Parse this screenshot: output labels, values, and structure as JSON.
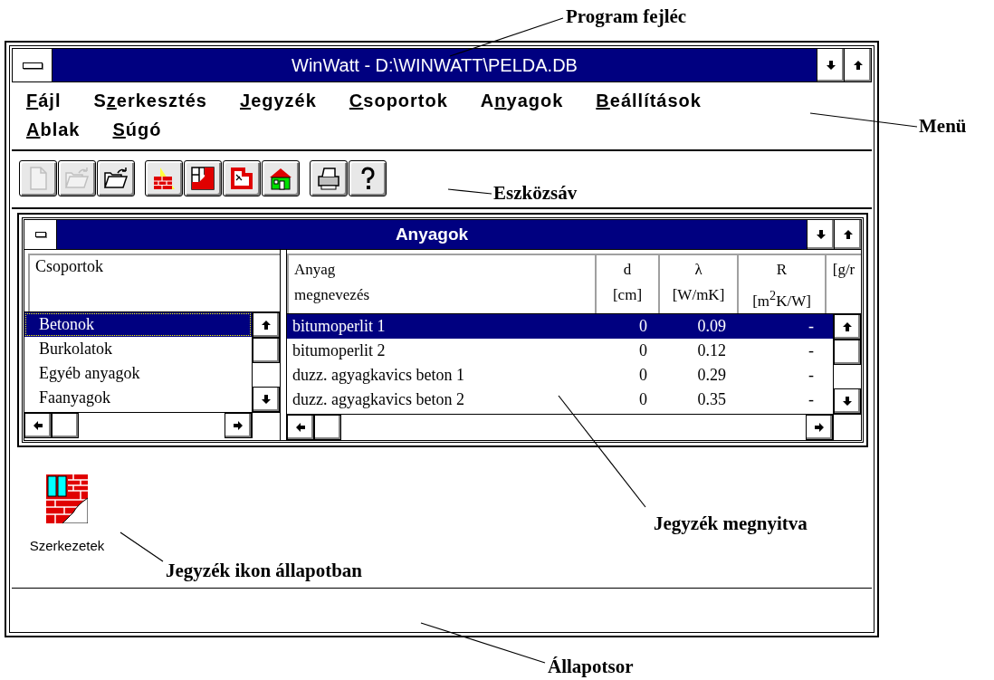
{
  "window": {
    "title": "WinWatt - D:\\WINWATT\\PELDA.DB"
  },
  "menu_rows": [
    [
      {
        "key": "F",
        "rest": "ájl"
      },
      {
        "lead": "S",
        "key": "z",
        "rest": "erkesztés"
      },
      {
        "key": "J",
        "rest": "egyzék"
      },
      {
        "key": "C",
        "rest": "soportok"
      },
      {
        "lead": "A",
        "key": "n",
        "rest": "yagok"
      },
      {
        "key": "B",
        "rest": "eállítások"
      }
    ],
    [
      {
        "key": "A",
        "rest": "blak"
      },
      {
        "key": "S",
        "rest": "úgó"
      }
    ]
  ],
  "toolbar": [
    [
      {
        "kind": "new-file",
        "disabled": true
      },
      {
        "kind": "open-folder",
        "disabled": true
      },
      {
        "kind": "open-folder",
        "disabled": false
      }
    ],
    [
      {
        "kind": "bricks",
        "disabled": false
      },
      {
        "kind": "wall",
        "disabled": false
      },
      {
        "kind": "floor-plan",
        "disabled": false
      },
      {
        "kind": "house",
        "disabled": false
      }
    ],
    [
      {
        "kind": "printer",
        "disabled": false
      },
      {
        "kind": "help",
        "disabled": false
      }
    ]
  ],
  "child_window": {
    "title": "Anyagok",
    "groups": {
      "heading": "Csoportok",
      "items": [
        {
          "label": "Betonok",
          "selected": true,
          "focused": true
        },
        {
          "label": "Burkolatok",
          "selected": false,
          "focused": false
        },
        {
          "label": "Egyéb anyagok",
          "selected": false,
          "focused": false
        },
        {
          "label": "Faanyagok",
          "selected": false,
          "focused": false
        }
      ]
    },
    "table": {
      "columns": [
        {
          "line1": "Anyag",
          "line2": "megnevezés"
        },
        {
          "line1": "d",
          "line2": "[cm]"
        },
        {
          "line1": "λ",
          "line2": "[W/mK]"
        },
        {
          "line1": "R",
          "line2": "[m$^{2}$K/W]"
        },
        {
          "line2": "[g/r"
        }
      ],
      "rows": [
        {
          "cells": [
            "bitumoperlit 1",
            "0",
            "0.09",
            "-"
          ],
          "selected": true
        },
        {
          "cells": [
            "bitumoperlit 2",
            "0",
            "0.12",
            "-"
          ],
          "selected": false
        },
        {
          "cells": [
            "duzz. agyagkavics beton 1",
            "0",
            "0.29",
            "-"
          ],
          "selected": false
        },
        {
          "cells": [
            "duzz. agyagkavics beton 2",
            "0",
            "0.35",
            "-"
          ],
          "selected": false
        }
      ]
    }
  },
  "minimized_window": {
    "label": "Szerkezetek"
  },
  "annotations": [
    {
      "text": "Program fejléc"
    },
    {
      "text": "Menü"
    },
    {
      "text": "Eszközsáv"
    },
    {
      "text": "Jegyzék megnyitva"
    },
    {
      "text": "Jegyzék ikon állapotban"
    },
    {
      "text": "Állapotsor"
    }
  ]
}
